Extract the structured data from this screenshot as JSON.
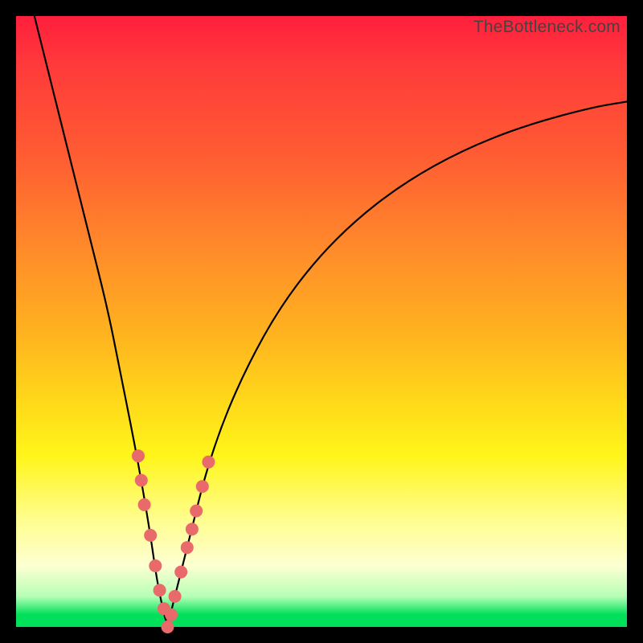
{
  "watermark": {
    "text": "TheBottleneck.com"
  },
  "colors": {
    "curve_stroke": "#000000",
    "marker_fill": "#e86a6a",
    "marker_stroke": "#d95a5a"
  },
  "chart_data": {
    "type": "line",
    "title": "",
    "xlabel": "",
    "ylabel": "",
    "xlim": [
      0,
      100
    ],
    "ylim": [
      0,
      100
    ],
    "grid": false,
    "legend": false,
    "series": [
      {
        "name": "curve",
        "x": [
          3,
          6,
          9,
          12,
          15,
          17,
          19,
          20.5,
          22,
          23,
          24,
          24.8,
          25.5,
          27,
          29,
          31,
          34,
          38,
          43,
          49,
          56,
          64,
          73,
          83,
          94,
          100
        ],
        "y": [
          100,
          88,
          76,
          64,
          52,
          42,
          32,
          24,
          15,
          8,
          3,
          0,
          3,
          9,
          17,
          25,
          34,
          43,
          52,
          60,
          67,
          73,
          78,
          82,
          85,
          86
        ]
      }
    ],
    "markers": [
      {
        "x": 20.0,
        "y": 28
      },
      {
        "x": 20.5,
        "y": 24
      },
      {
        "x": 21.0,
        "y": 20
      },
      {
        "x": 22.0,
        "y": 15
      },
      {
        "x": 22.8,
        "y": 10
      },
      {
        "x": 23.5,
        "y": 6
      },
      {
        "x": 24.2,
        "y": 3
      },
      {
        "x": 24.8,
        "y": 0
      },
      {
        "x": 25.4,
        "y": 2
      },
      {
        "x": 26.0,
        "y": 5
      },
      {
        "x": 27.0,
        "y": 9
      },
      {
        "x": 28.0,
        "y": 13
      },
      {
        "x": 28.8,
        "y": 16
      },
      {
        "x": 29.5,
        "y": 19
      },
      {
        "x": 30.5,
        "y": 23
      },
      {
        "x": 31.5,
        "y": 27
      }
    ]
  }
}
